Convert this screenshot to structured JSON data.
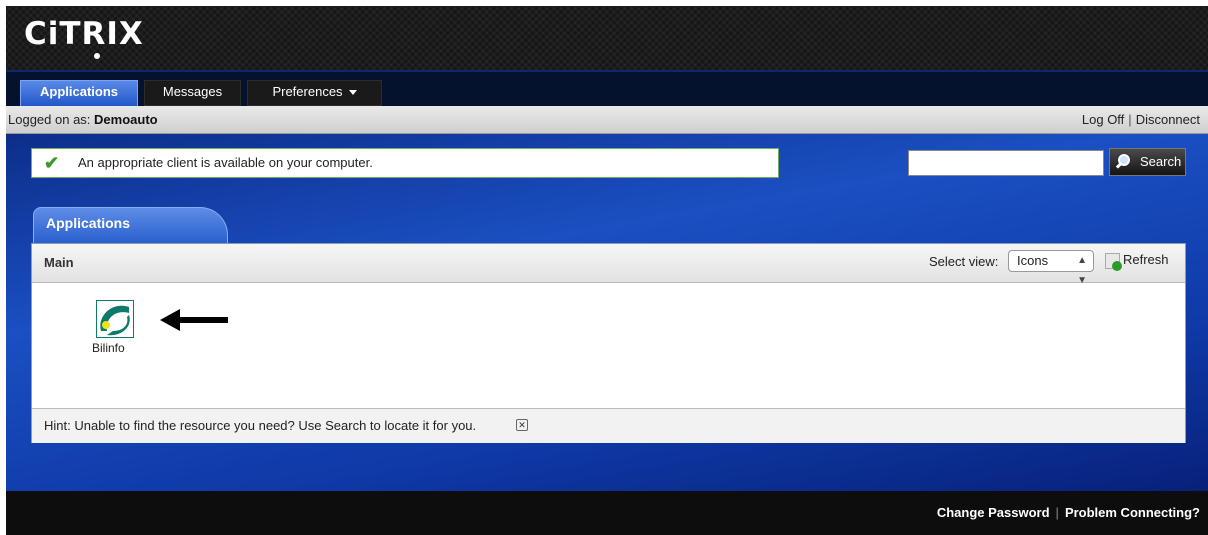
{
  "brand": "CiTRIX",
  "nav": {
    "tabs": [
      {
        "label": "Applications"
      },
      {
        "label": "Messages"
      },
      {
        "label": "Preferences"
      }
    ]
  },
  "status": {
    "logged_prefix": "Logged on as: ",
    "user": "Demoauto",
    "log_off": "Log Off",
    "disconnect": "Disconnect"
  },
  "notice": {
    "text": "An appropriate client is available on your computer."
  },
  "search": {
    "value": "",
    "button_label": "Search"
  },
  "apps_panel": {
    "tab_label": "Applications",
    "folder": "Main",
    "select_view_label": "Select view:",
    "view_value": "Icons",
    "refresh_label": "Refresh",
    "apps": [
      {
        "name": "Bilinfo"
      }
    ],
    "hint": "Hint: Unable to find the resource you need? Use Search to locate it for you."
  },
  "footer": {
    "change_password": "Change Password",
    "problem_connecting": "Problem Connecting?"
  },
  "colors": {
    "accent_blue": "#2157c8",
    "check_green": "#3d9a2a",
    "app_icon_teal": "#0f7a6a",
    "app_icon_yellow": "#f2e21b"
  }
}
